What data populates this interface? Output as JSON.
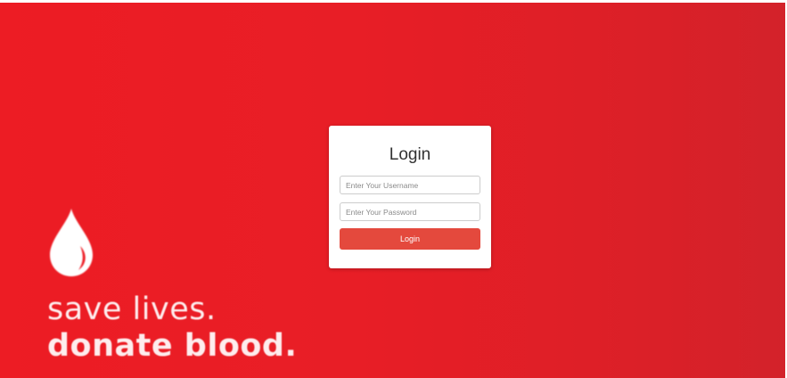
{
  "branding": {
    "drop_icon": "blood-drop-icon",
    "slogan_line1": "save lives.",
    "slogan_line2": "donate blood."
  },
  "login": {
    "title": "Login",
    "username_placeholder": "Enter Your Username",
    "username_value": "",
    "password_placeholder": "Enter Your Password",
    "password_value": "",
    "button_label": "Login"
  },
  "colors": {
    "background_start": "#ed1c24",
    "background_end": "#d3222a",
    "button": "#e4493d",
    "card": "#ffffff"
  }
}
